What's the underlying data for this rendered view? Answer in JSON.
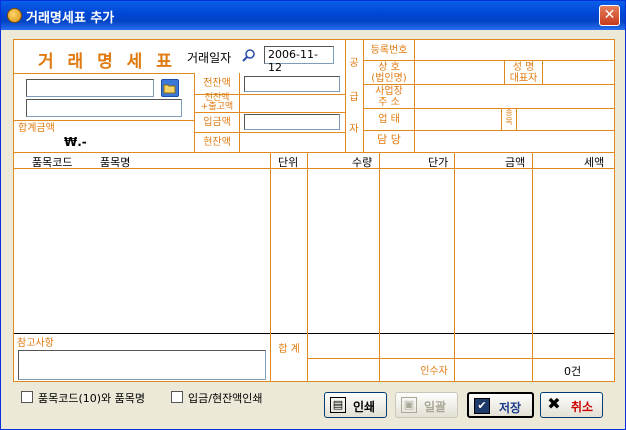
{
  "window": {
    "title": "거래명세표 추가",
    "close_glyph": "✕"
  },
  "doc": {
    "heading": "거 래 명 세 표",
    "date_label": "거래일자",
    "date_value": "2006-11-12",
    "total_label": "합계금액",
    "total_value": "₩.-",
    "balance_labels": {
      "prev": "전잔액",
      "prev_plus": "전잔액\n+출고액",
      "deposit": "입금액",
      "current": "현잔액"
    }
  },
  "supplier": {
    "side_chars": [
      "공",
      "급",
      "자"
    ],
    "reg_no": "등록번호",
    "company": "상  호\n(법인명)",
    "name": "성  명\n대표자",
    "address": "사업장\n주  소",
    "business": "업  태",
    "item": "종목",
    "contact": "담 당"
  },
  "table": {
    "columns": [
      "품목코드",
      "품목명",
      "단위",
      "수량",
      "단가",
      "금액",
      "세액"
    ]
  },
  "footer": {
    "remarks_label": "참고사항",
    "sum_label": "합  계",
    "receiver_label": "인수자",
    "count": "0건"
  },
  "options": {
    "opt1": "품목코드(10)와 품목명",
    "opt2": "입금/현잔액인쇄"
  },
  "buttons": {
    "print": "인쇄",
    "batch": "일괄",
    "save": "저장",
    "cancel": "취소"
  }
}
